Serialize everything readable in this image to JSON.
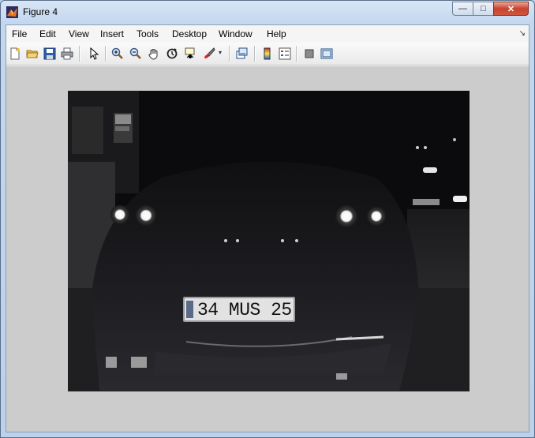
{
  "window": {
    "title": "Figure 4"
  },
  "menu": [
    "File",
    "Edit",
    "View",
    "Insert",
    "Tools",
    "Desktop",
    "Window",
    "Help"
  ],
  "toolbar": {
    "buttons": [
      "new-figure",
      "open-file",
      "save",
      "print",
      "edit-plot",
      "zoom-in",
      "zoom-out",
      "pan",
      "rotate-3d",
      "data-cursor",
      "brush",
      "link-plot",
      "colorbar",
      "legend",
      "hide-plot-tools",
      "show-plot-tools"
    ]
  },
  "image": {
    "description_hidden": "",
    "plate_text": "34 MUS 25",
    "colors": {
      "background": "#cccccc",
      "photo_dark": "#0c0c0e"
    }
  }
}
